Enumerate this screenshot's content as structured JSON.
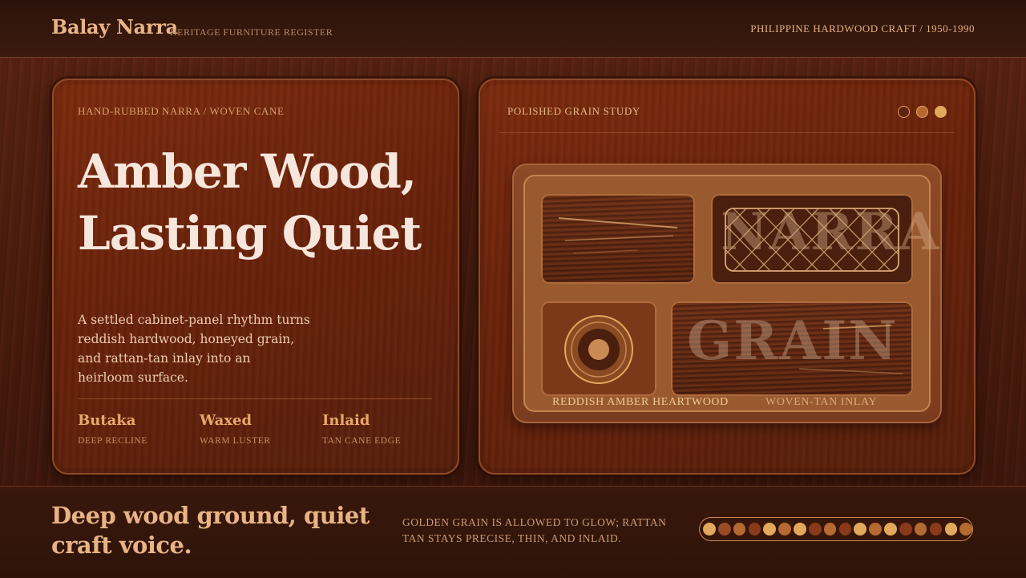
{
  "header": {
    "brand": "Balay Narra",
    "subtitle": "HERITAGE FURNITURE REGISTER",
    "craft_line": "PHILIPPINE HARDWOOD CRAFT / 1950-1990"
  },
  "hero": {
    "kicker": "HAND-RUBBED NARRA / WOVEN CANE",
    "title": "Amber Wood, Lasting Quiet",
    "description": "A settled cabinet-panel rhythm turns reddish hardwood, honeyed grain, and rattan-tan inlay into an heirloom surface.",
    "stats": [
      {
        "title": "Butaka",
        "sub": "DEEP RECLINE"
      },
      {
        "title": "Waxed",
        "sub": "WARM LUSTER"
      },
      {
        "title": "Inlaid",
        "sub": "TAN CANE EDGE"
      }
    ]
  },
  "study": {
    "kicker": "POLISHED GRAIN STUDY",
    "dots": [
      "#5a2410",
      "#b46a30",
      "#e2a85c"
    ],
    "word_top": "NARRA",
    "word_bottom": "GRAIN",
    "label_left": "REDDISH AMBER HEARTWOOD",
    "label_right": "WOVEN-TAN INLAY"
  },
  "footer": {
    "headline": "Deep wood ground, quiet craft voice.",
    "note": "GOLDEN GRAIN IS ALLOWED TO GLOW; RATTAN TAN STAYS PRECISE, THIN, AND INLAID.",
    "beads": [
      "#e2a85c",
      "#9a4a24",
      "#b46a30",
      "#8a3a1a",
      "#e2a85c",
      "#b46a30",
      "#e2a85c",
      "#8a3a1a",
      "#b46a30",
      "#8a3a1a",
      "#e2a85c",
      "#b46a30",
      "#e2a85c",
      "#8a3a1a",
      "#b46a30",
      "#8a3a1a",
      "#e2a85c",
      "#b46a30"
    ]
  }
}
